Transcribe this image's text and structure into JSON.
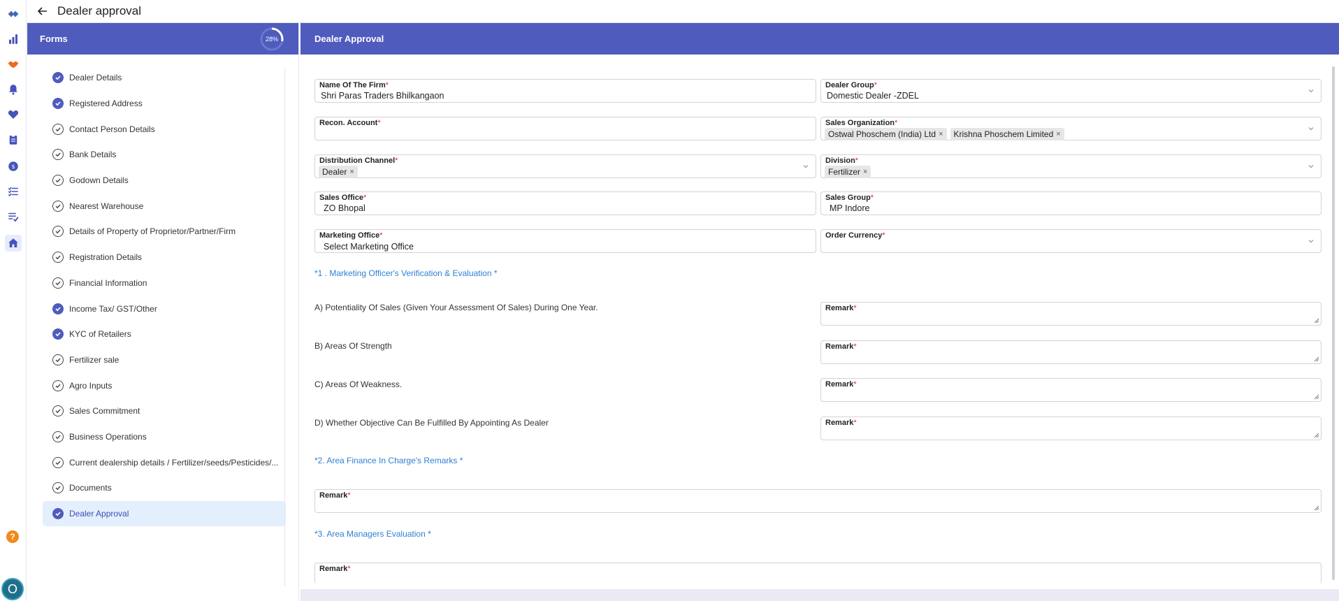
{
  "app": {
    "page_title": "Dealer approval",
    "rail_icons": [
      "logo-icon",
      "chart-icon",
      "handshake-icon",
      "bell-icon",
      "heart-icon",
      "clipboard-icon",
      "coin-icon",
      "checklist-icon",
      "tasks-icon",
      "home-icon"
    ],
    "help_icon": "?",
    "avatar_initial": "O",
    "accent": "#4f5bbd"
  },
  "forms": {
    "title": "Forms",
    "progress_label": "28%",
    "progress_fraction": 0.28,
    "items": [
      {
        "label": "Dealer Details",
        "status": "done"
      },
      {
        "label": "Registered Address",
        "status": "done"
      },
      {
        "label": "Contact Person Details",
        "status": "open"
      },
      {
        "label": "Bank Details",
        "status": "open"
      },
      {
        "label": "Godown Details",
        "status": "open"
      },
      {
        "label": "Nearest Warehouse",
        "status": "open"
      },
      {
        "label": "Details of Property of Proprietor/Partner/Firm",
        "status": "open"
      },
      {
        "label": "Registration Details",
        "status": "open"
      },
      {
        "label": "Financial Information",
        "status": "open"
      },
      {
        "label": "Income Tax/ GST/Other",
        "status": "done"
      },
      {
        "label": "KYC of Retailers",
        "status": "done"
      },
      {
        "label": "Fertilizer sale",
        "status": "open"
      },
      {
        "label": "Agro Inputs",
        "status": "open"
      },
      {
        "label": "Sales Commitment",
        "status": "open"
      },
      {
        "label": "Business Operations",
        "status": "open"
      },
      {
        "label": "Current dealership details / Fertilizer/seeds/Pesticides/...",
        "status": "open"
      },
      {
        "label": "Documents",
        "status": "open"
      },
      {
        "label": "Dealer Approval",
        "status": "done",
        "selected": true
      }
    ]
  },
  "main": {
    "title": "Dealer Approval",
    "fields": {
      "firm_name": {
        "label": "Name Of The Firm",
        "value": "Shri Paras Traders Bhilkangaon"
      },
      "dealer_group": {
        "label": "Dealer Group",
        "value": "Domestic Dealer -ZDEL"
      },
      "recon_account": {
        "label": "Recon. Account",
        "value": ""
      },
      "sales_org": {
        "label": "Sales Organization",
        "chips": [
          "Ostwal Phoschem (India) Ltd",
          "Krishna Phoschem Limited"
        ]
      },
      "distribution_channel": {
        "label": "Distribution Channel",
        "chips": [
          "Dealer"
        ]
      },
      "division": {
        "label": "Division",
        "chips": [
          "Fertilizer"
        ]
      },
      "sales_office": {
        "label": "Sales Office",
        "value": "ZO Bhopal"
      },
      "sales_group": {
        "label": "Sales Group",
        "value": "MP Indore"
      },
      "marketing_office": {
        "label": "Marketing Office",
        "value": "Select Marketing Office"
      },
      "order_currency": {
        "label": "Order Currency",
        "value": ""
      }
    },
    "section1": "*1 . Marketing Officer's Verification & Evaluation *",
    "questions": [
      "A) Potentiality Of Sales (Given Your Assessment Of Sales) During One Year.",
      "B) Areas Of Strength",
      "C) Areas Of Weakness.",
      "D) Whether Objective Can Be Fulfilled By Appointing As Dealer"
    ],
    "remark_label": "Remark",
    "section2": "*2. Area Finance In Charge's Remarks *",
    "section3": "*3. Area Managers Evaluation *"
  }
}
